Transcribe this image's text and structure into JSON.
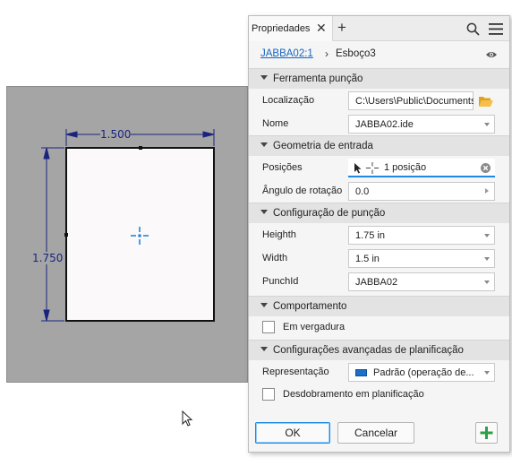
{
  "sketch": {
    "width_dimension": "1.500",
    "height_dimension": "1.750"
  },
  "panel": {
    "tab_label": "Propriedades",
    "breadcrumb": {
      "parent": "JABBA02:1",
      "current": "Esboço3"
    },
    "sections": {
      "punch_tool": "Ferramenta punção",
      "input_geometry": "Geometria de entrada",
      "punch_config": "Configuração de punção",
      "behavior": "Comportamento",
      "advanced_flat": "Configurações avançadas de planificação"
    },
    "fields": {
      "location": {
        "label": "Localização",
        "value": "C:\\Users\\Public\\Documents\\"
      },
      "name": {
        "label": "Nome",
        "value": "JABBA02.ide"
      },
      "positions": {
        "label": "Posições",
        "value": "1 posição"
      },
      "rotation_angle": {
        "label": "Ângulo de rotação",
        "value": "0.0"
      },
      "height": {
        "label": "Heighth",
        "value": "1.75 in"
      },
      "width": {
        "label": "Width",
        "value": "1.5 in"
      },
      "punch_id": {
        "label": "PunchId",
        "value": "JABBA02"
      },
      "representation": {
        "label": "Representação",
        "value": "Padrão (operação de..."
      }
    },
    "checkboxes": {
      "in_bend": {
        "label": "Em vergadura",
        "checked": false
      },
      "unfold_in_flat": {
        "label": "Desdobramento em planificação",
        "checked": false
      }
    },
    "buttons": {
      "ok": "OK",
      "cancel": "Cancelar"
    }
  },
  "colors": {
    "dimension": "#1a237e",
    "centermark": "#1e88e5",
    "link": "#1565c0",
    "add_button": "#2e9e47"
  }
}
